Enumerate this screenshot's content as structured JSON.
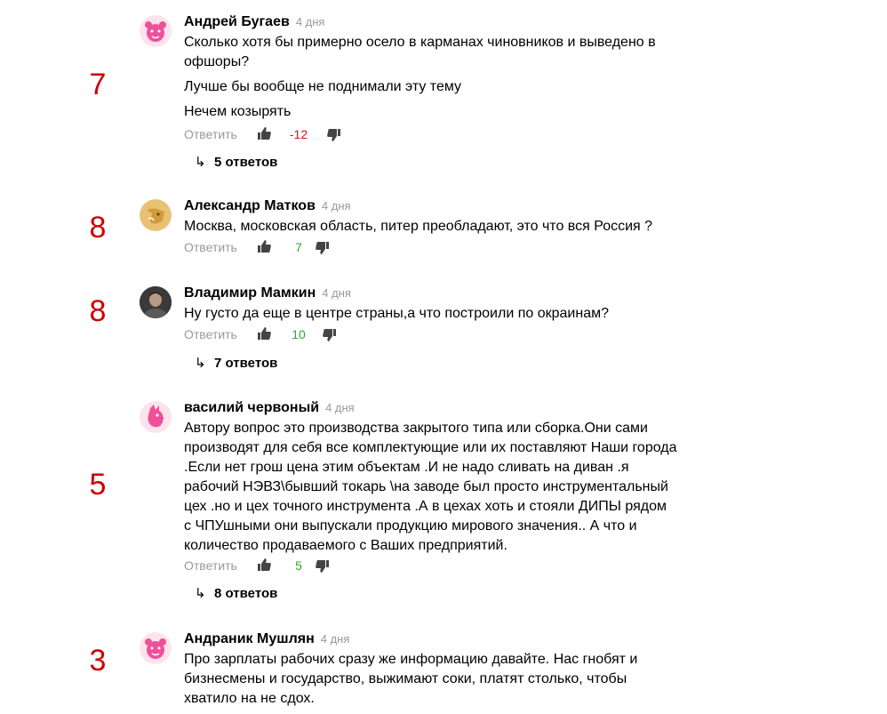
{
  "comments": [
    {
      "score": "7",
      "author": "Андрей Бугаев",
      "time": "4 дня",
      "avatar": "pink-bear-icon",
      "lines": [
        "Сколько хотя бы примерно осело в карманах чиновников и выведено в офшоры?",
        "Лучше бы вообще не поднимали эту тему",
        "Нечем козырять"
      ],
      "reply_label": "Ответить",
      "rating": "-12",
      "replies": "5 ответов"
    },
    {
      "score": "8",
      "author": "Александр Матков",
      "time": "4 дня",
      "avatar": "golden-fox-icon",
      "lines": [
        "Москва, московская область, питер преобладают, это что вся Россия ?"
      ],
      "reply_label": "Ответить",
      "rating": "7"
    },
    {
      "score": "8",
      "author": "Владимир Мамкин",
      "time": "4 дня",
      "avatar": "user-photo",
      "lines": [
        "Ну густо да еще в центре страны,а что построили по окраинам?"
      ],
      "reply_label": "Ответить",
      "rating": "10",
      "replies": "7 ответов"
    },
    {
      "score": "5",
      "author": "василий червоный",
      "time": "4 дня",
      "avatar": "pink-bird-icon",
      "lines": [
        "Автору вопрос это производства закрытого типа или сборка.Они сами производят для себя все комплектующие или их поставляют Наши города .Если нет грош цена этим объектам .И не надо сливать на диван .я рабочий НЭВЗ\\бывший токарь \\на заводе был просто инструментальный цех .но и цех точного инструмента .А в цехах хоть и стояли ДИПЫ рядом с ЧПУшными они выпускали продукцию мирового значения.. А что и количество продаваемого с Ваших предприятий."
      ],
      "reply_label": "Ответить",
      "rating": "5",
      "replies": "8 ответов"
    },
    {
      "score": "3",
      "author": "Андраник Мушлян",
      "time": "4 дня",
      "avatar": "pink-bear-icon",
      "lines": [
        "Про зарплаты рабочих сразу же информацию давайте. Нас гнобят и бизнесмены и государство, выжимают соки, платят столько, чтобы хватило на не сдох."
      ]
    }
  ],
  "colors": {
    "negative": "#e0121b",
    "positive": "#2daa2d",
    "score": "#cc0000",
    "muted": "#999999"
  }
}
